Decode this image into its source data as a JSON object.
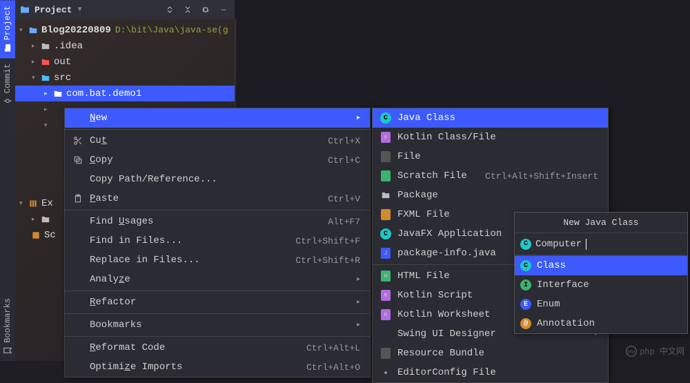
{
  "sidebar": {
    "project": "Project",
    "commit": "Commit",
    "bookmarks": "Bookmarks"
  },
  "panel": {
    "title": "Project",
    "root": "Blog20220809",
    "root_path": "D:\\bit\\Java\\java-se(g",
    "nodes": {
      "idea": ".idea",
      "out": "out",
      "src": "src",
      "pkg": "com.bat.demo1",
      "ext": "Ex",
      "scr": "Sc"
    }
  },
  "menu1": {
    "new": "New",
    "cut": "Cut",
    "copy": "Copy",
    "copy_path": "Copy Path/Reference...",
    "paste": "Paste",
    "find_usages": "Find Usages",
    "find_in_files": "Find in Files...",
    "replace_in_files": "Replace in Files...",
    "analyze": "Analyze",
    "refactor": "Refactor",
    "bookmarks": "Bookmarks",
    "reformat": "Reformat Code",
    "optimize": "Optimize Imports",
    "sc": {
      "cut": "Ctrl+X",
      "copy": "Ctrl+C",
      "paste": "Ctrl+V",
      "usages": "Alt+F7",
      "find": "Ctrl+Shift+F",
      "replace": "Ctrl+Shift+R",
      "reformat": "Ctrl+Alt+L",
      "optimize": "Ctrl+Alt+O"
    }
  },
  "menu2": {
    "java_class": "Java Class",
    "kotlin": "Kotlin Class/File",
    "file": "File",
    "scratch": "Scratch File",
    "scratch_sc": "Ctrl+Alt+Shift+Insert",
    "package": "Package",
    "fxml": "FXML File",
    "javafx": "JavaFX Application",
    "pkginfo": "package-info.java",
    "html": "HTML File",
    "kscript": "Kotlin Script",
    "kws": "Kotlin Worksheet",
    "swing": "Swing UI Designer",
    "bundle": "Resource Bundle",
    "editorconfig": "EditorConfig File"
  },
  "dialog": {
    "title": "New Java Class",
    "input": "Computer",
    "opts": {
      "class": "Class",
      "interface": "Interface",
      "enum": "Enum",
      "annotation": "Annotation"
    }
  },
  "watermark": "php 中文网"
}
